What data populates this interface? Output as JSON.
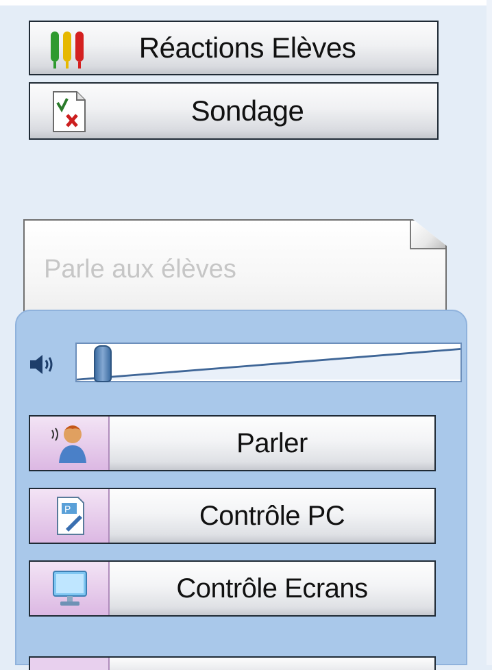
{
  "actions": {
    "reactions_label": "Réactions Elèves",
    "sondage_label": "Sondage"
  },
  "note": {
    "placeholder": "Parle aux élèves"
  },
  "audio_panel": {
    "volume_level": 0.05,
    "buttons": [
      {
        "label": "Parler",
        "icon": "talking-person-icon"
      },
      {
        "label": "Contrôle PC",
        "icon": "pc-control-icon"
      },
      {
        "label": "Contrôle Ecrans",
        "icon": "monitor-icon"
      }
    ]
  },
  "colors": {
    "panel_blue": "#a9c8ea",
    "background": "#e4edf7",
    "icon_box_purple": "#dcb8e3"
  }
}
